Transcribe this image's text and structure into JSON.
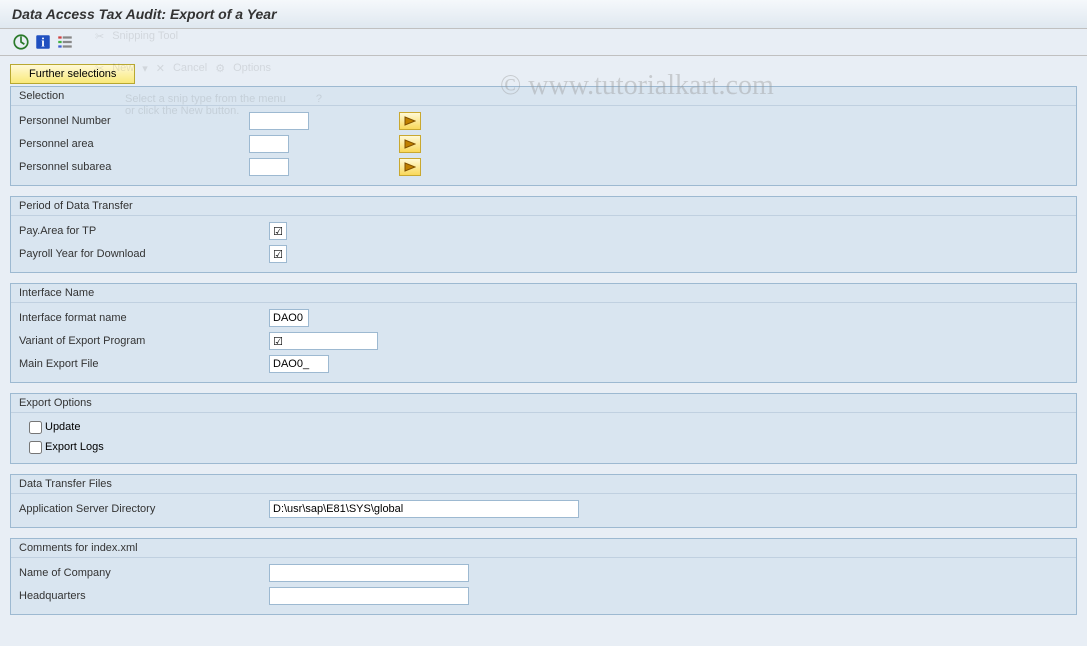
{
  "title": "Data Access Tax Audit: Export of a Year",
  "watermark": "© www.tutorialkart.com",
  "toolbar": {
    "further_selections": "Further selections"
  },
  "ghost": {
    "title": "Snipping Tool",
    "new": "New",
    "cancel": "Cancel",
    "options": "Options",
    "hint1": "Select a snip type from the menu",
    "hint2": "or click the New button."
  },
  "groups": {
    "selection": {
      "title": "Selection",
      "personnel_number": "Personnel Number",
      "personnel_area": "Personnel area",
      "personnel_subarea": "Personnel subarea",
      "personnel_number_val": "",
      "personnel_area_val": "",
      "personnel_subarea_val": ""
    },
    "period": {
      "title": "Period of Data Transfer",
      "pay_area": "Pay.Area for TP",
      "payroll_year": "Payroll Year for Download"
    },
    "interface": {
      "title": "Interface Name",
      "format_name_label": "Interface format name",
      "format_name_val": "DAO0",
      "variant_label": "Variant of Export Program",
      "main_file_label": "Main Export File",
      "main_file_val": "DAO0_"
    },
    "export_options": {
      "title": "Export Options",
      "update": "Update",
      "export_logs": "Export Logs"
    },
    "data_transfer": {
      "title": "Data Transfer Files",
      "app_server_label": "Application Server Directory",
      "app_server_val": "D:\\usr\\sap\\E81\\SYS\\global"
    },
    "comments": {
      "title": "Comments for index.xml",
      "company_label": "Name of Company",
      "company_val": "",
      "hq_label": "Headquarters",
      "hq_val": ""
    }
  }
}
